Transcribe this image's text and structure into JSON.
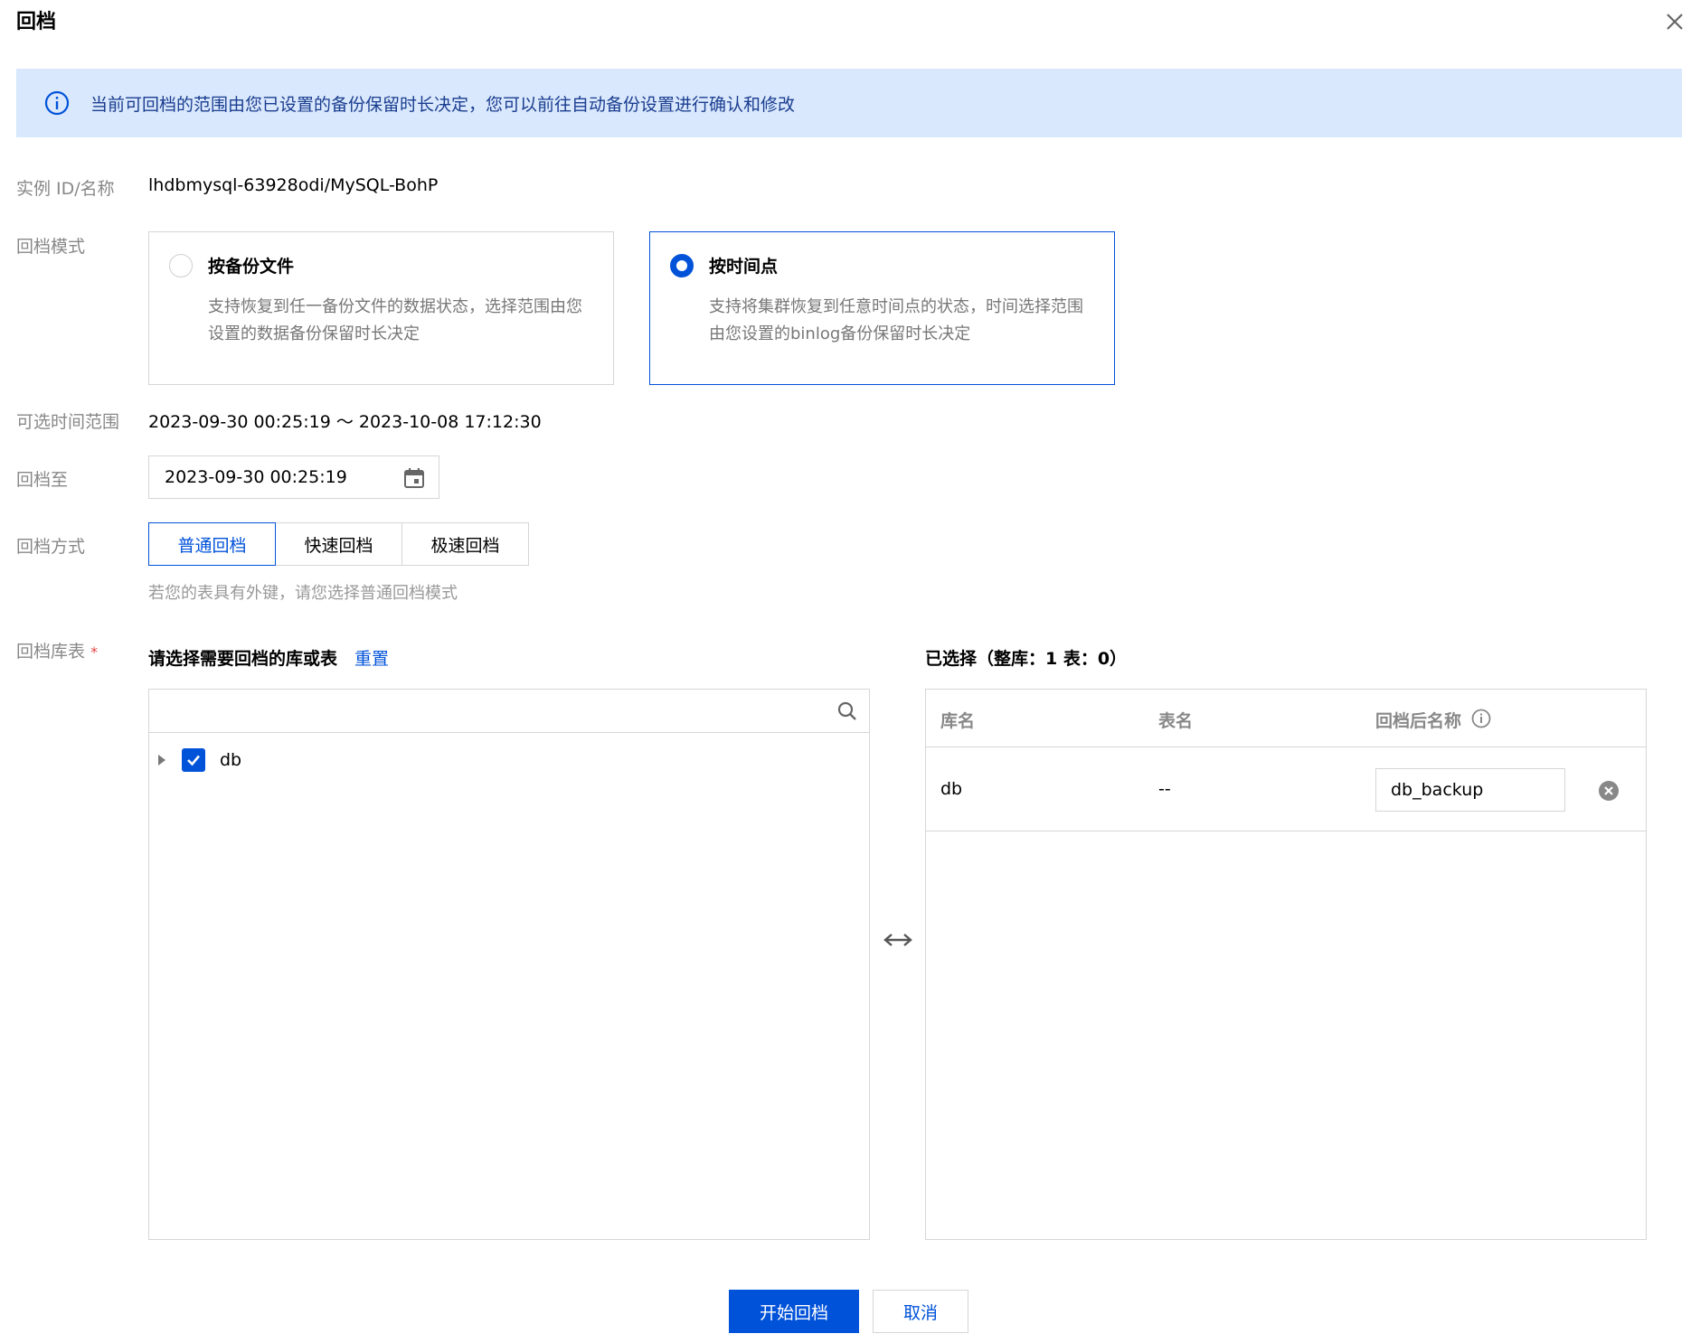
{
  "dialog": {
    "title": "回档"
  },
  "info_banner": {
    "text": "当前可回档的范围由您已设置的备份保留时长决定，您可以前往自动备份设置进行确认和修改"
  },
  "instance": {
    "label": "实例 ID/名称",
    "value": "lhdbmysql-63928odi/MySQL-BohP"
  },
  "mode": {
    "label": "回档模式",
    "options": [
      {
        "title": "按备份文件",
        "desc": "支持恢复到任一备份文件的数据状态，选择范围由您设置的数据备份保留时长决定",
        "selected": false
      },
      {
        "title": "按时间点",
        "desc": "支持将集群恢复到任意时间点的状态，时间选择范围由您设置的binlog备份保留时长决定",
        "selected": true
      }
    ]
  },
  "time_range": {
    "label": "可选时间范围",
    "value": "2023-09-30 00:25:19 ～ 2023-10-08 17:12:30"
  },
  "rollback_to": {
    "label": "回档至",
    "value": "2023-09-30 00:25:19"
  },
  "method": {
    "label": "回档方式",
    "options": [
      "普通回档",
      "快速回档",
      "极速回档"
    ],
    "selected": "普通回档",
    "hint": "若您的表具有外键，请您选择普通回档模式"
  },
  "tables": {
    "label": "回档库表",
    "required_mark": "*",
    "left_heading": "请选择需要回档的库或表",
    "reset_link": "重置",
    "search_placeholder": "",
    "tree": [
      {
        "name": "db",
        "checked": true,
        "expanded": false
      }
    ],
    "right_heading": "已选择（整库：1 表：0）",
    "columns": [
      "库名",
      "表名",
      "回档后名称"
    ],
    "rows": [
      {
        "db": "db",
        "table": "--",
        "new_name": "db_backup"
      }
    ]
  },
  "footer": {
    "confirm": "开始回档",
    "cancel": "取消"
  },
  "colors": {
    "primary": "#0052d9",
    "banner_bg": "#d9e8fd",
    "border": "#d6d6d6"
  }
}
